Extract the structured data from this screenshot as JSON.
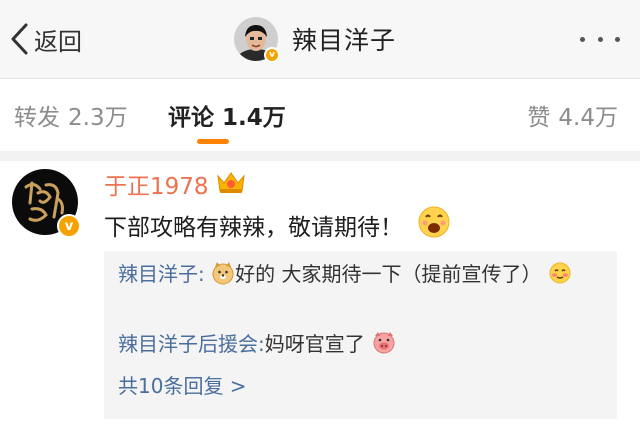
{
  "nav": {
    "back_label": "返回",
    "title": "辣目洋子",
    "verified_mark": "v",
    "more_icon": "more-dots-icon"
  },
  "tabs": [
    {
      "label": "转发",
      "count": "2.3万",
      "active": false
    },
    {
      "label": "评论",
      "count": "1.4万",
      "active": true
    },
    {
      "label": "赞",
      "count": "4.4万",
      "active": false
    }
  ],
  "comment": {
    "username": "于正1978",
    "verified_mark": "v",
    "text": "下部攻略有辣辣，敬请期待！",
    "emoji": "grinning-emoji",
    "replies": [
      {
        "user": "辣目洋子:",
        "text_a": "好的 大家期待一下（提前宣传了）",
        "emoji_a": "doge-emoji",
        "emoji_b": "shy-emoji"
      },
      {
        "user": "辣目洋子后援会:",
        "text_a": "妈呀官宣了",
        "emoji_a": "pig-emoji"
      }
    ],
    "view_all": "共10条回复 >"
  },
  "colors": {
    "accent": "#ff8200",
    "username": "#eb7350",
    "link": "#4a6e9e",
    "verified": "#f5a300"
  }
}
